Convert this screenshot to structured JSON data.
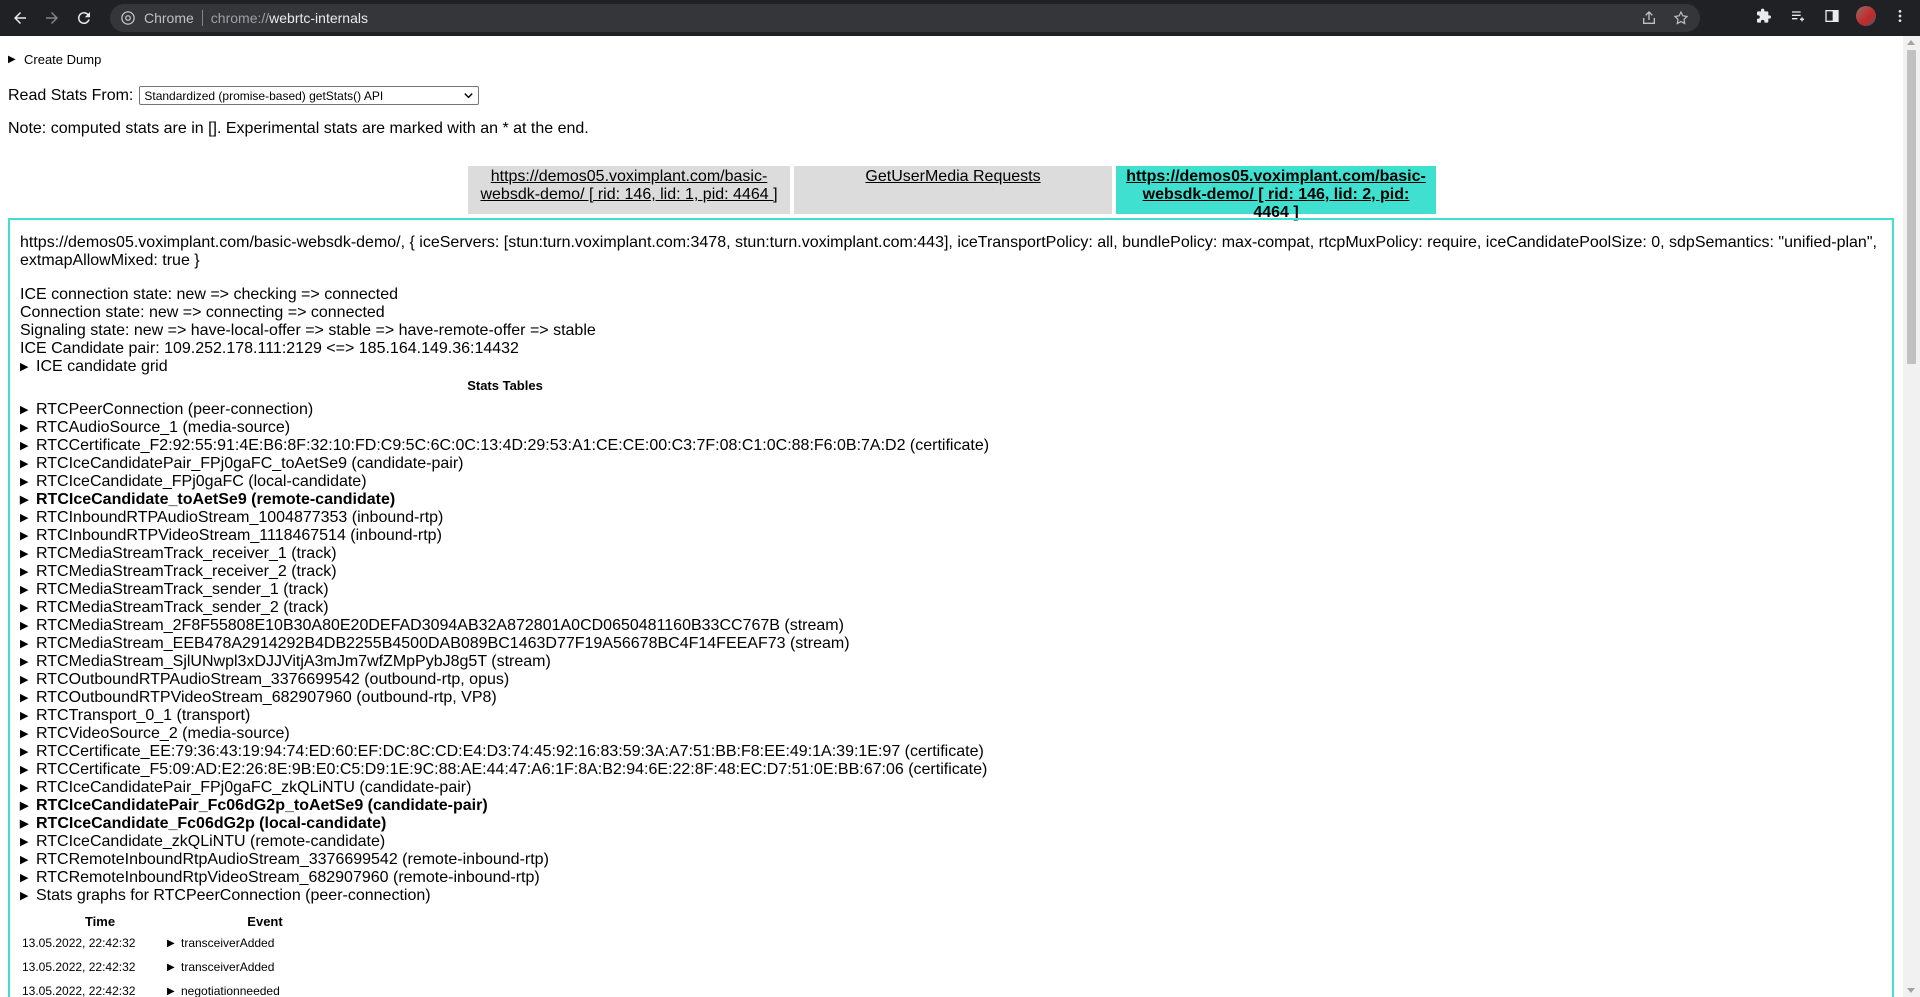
{
  "browser": {
    "scheme_label": "Chrome",
    "url_prefix": "chrome://",
    "url_host": "webrtc-internals"
  },
  "page": {
    "create_dump": "Create Dump",
    "read_stats_label": "Read Stats From:",
    "read_stats_selected": "Standardized (promise-based) getStats() API",
    "note": "Note: computed stats are in []. Experimental stats are marked with an * at the end."
  },
  "tabs": [
    {
      "line1": "https://demos05.voximplant.com/basic-",
      "line2": "websdk-demo/ [ rid: 146, lid: 1, pid: 4464 ]"
    },
    {
      "line1": "GetUserMedia Requests",
      "line2": ""
    },
    {
      "line1": "https://demos05.voximplant.com/basic-",
      "line2": "websdk-demo/ [ rid: 146, lid: 2, pid: 4464 ]"
    }
  ],
  "panel": {
    "config": "https://demos05.voximplant.com/basic-websdk-demo/, { iceServers: [stun:turn.voximplant.com:3478, stun:turn.voximplant.com:443], iceTransportPolicy: all, bundlePolicy: max-compat, rtcpMuxPolicy: require, iceCandidatePoolSize: 0, sdpSemantics: \"unified-plan\", extmapAllowMixed: true }",
    "ice_state": "ICE connection state: new => checking => connected",
    "conn_state": "Connection state: new => connecting => connected",
    "sig_state": "Signaling state: new => have-local-offer => stable => have-remote-offer => stable",
    "ice_pair": "ICE Candidate pair: 109.252.178.111:2129 <=> 185.164.149.36:14432",
    "ice_grid": "ICE candidate grid",
    "stats_tables_title": "Stats Tables",
    "stats_items": [
      "RTCPeerConnection (peer-connection)",
      "RTCAudioSource_1 (media-source)",
      "RTCCertificate_F2:92:55:91:4E:B6:8F:32:10:FD:C9:5C:6C:0C:13:4D:29:53:A1:CE:CE:00:C3:7F:08:C1:0C:88:F6:0B:7A:D2 (certificate)",
      "RTCIceCandidatePair_FPj0gaFC_toAetSe9 (candidate-pair)",
      "RTCIceCandidate_FPj0gaFC (local-candidate)",
      "RTCIceCandidate_toAetSe9 (remote-candidate)",
      "RTCInboundRTPAudioStream_1004877353 (inbound-rtp)",
      "RTCInboundRTPVideoStream_1118467514 (inbound-rtp)",
      "RTCMediaStreamTrack_receiver_1 (track)",
      "RTCMediaStreamTrack_receiver_2 (track)",
      "RTCMediaStreamTrack_sender_1 (track)",
      "RTCMediaStreamTrack_sender_2 (track)",
      "RTCMediaStream_2F8F55808E10B30A80E20DEFAD3094AB32A872801A0CD0650481160B33CC767B (stream)",
      "RTCMediaStream_EEB478A2914292B4DB2255B4500DAB089BC1463D77F19A56678BC4F14FEEAF73 (stream)",
      "RTCMediaStream_SjlUNwpl3xDJJVitjA3mJm7wfZMpPybJ8g5T (stream)",
      "RTCOutboundRTPAudioStream_3376699542 (outbound-rtp, opus)",
      "RTCOutboundRTPVideoStream_682907960 (outbound-rtp, VP8)",
      "RTCTransport_0_1 (transport)",
      "RTCVideoSource_2 (media-source)",
      "RTCCertificate_EE:79:36:43:19:94:74:ED:60:EF:DC:8C:CD:E4:D3:74:45:92:16:83:59:3A:A7:51:BB:F8:EE:49:1A:39:1E:97 (certificate)",
      "RTCCertificate_F5:09:AD:E2:26:8E:9B:E0:C5:D9:1E:9C:88:AE:44:47:A6:1F:8A:B2:94:6E:22:8F:48:EC:D7:51:0E:BB:67:06 (certificate)",
      "RTCIceCandidatePair_FPj0gaFC_zkQLiNTU (candidate-pair)",
      "RTCIceCandidatePair_Fc06dG2p_toAetSe9 (candidate-pair)",
      "RTCIceCandidate_Fc06dG2p (local-candidate)",
      "RTCIceCandidate_zkQLiNTU (remote-candidate)",
      "RTCRemoteInboundRtpAudioStream_3376699542 (remote-inbound-rtp)",
      "RTCRemoteInboundRtpVideoStream_682907960 (remote-inbound-rtp)",
      "Stats graphs for RTCPeerConnection (peer-connection)"
    ],
    "bold_indices": [
      5,
      22,
      23
    ],
    "events_header": {
      "time": "Time",
      "event": "Event"
    },
    "events": [
      {
        "time": "13.05.2022, 22:42:32",
        "event": "transceiverAdded"
      },
      {
        "time": "13.05.2022, 22:42:32",
        "event": "transceiverAdded"
      },
      {
        "time": "13.05.2022, 22:42:32",
        "event": "negotiationneeded"
      }
    ]
  }
}
